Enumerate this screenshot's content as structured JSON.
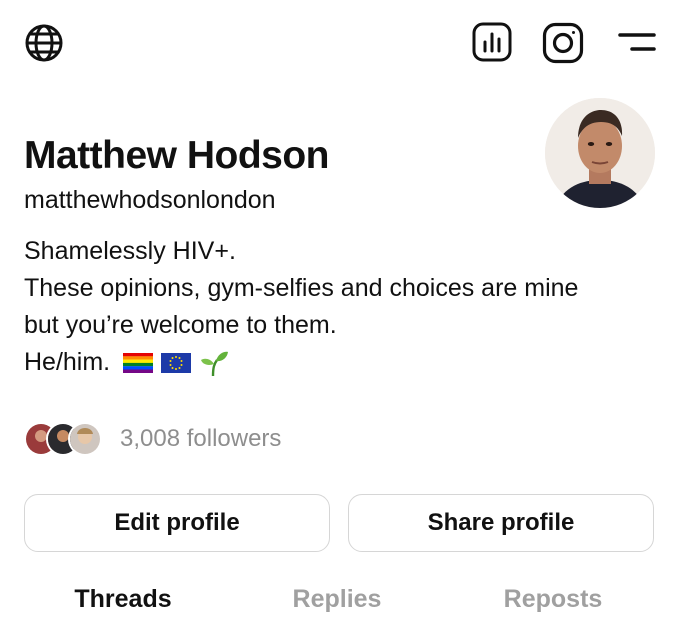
{
  "profile": {
    "name": "Matthew Hodson",
    "handle": "matthewhodsonlondon",
    "bio_lines": [
      "Shamelessly HIV+.",
      "These opinions, gym-selfies and choices are mine",
      "but you’re welcome to them.",
      "He/him."
    ],
    "bio_emojis": [
      "rainbow-flag",
      "eu-flag",
      "seedling"
    ],
    "followers_text": "3,008 followers"
  },
  "topbar": {
    "icons": [
      "globe-icon",
      "insights-icon",
      "instagram-icon",
      "menu-icon"
    ]
  },
  "actions": {
    "edit_label": "Edit profile",
    "share_label": "Share profile"
  },
  "tabs": [
    {
      "label": "Threads",
      "active": true
    },
    {
      "label": "Replies",
      "active": false
    },
    {
      "label": "Reposts",
      "active": false
    }
  ],
  "colors": {
    "text": "#111111",
    "muted": "#8e8e8e",
    "inactive_tab": "#a0a0a0",
    "border": "#d6d6d6"
  }
}
